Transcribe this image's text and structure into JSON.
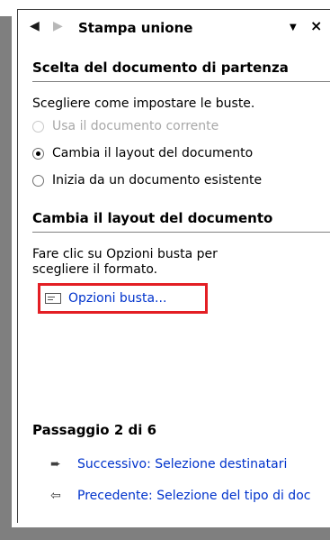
{
  "header": {
    "back_icon": "arrow-left-icon",
    "forward_icon": "arrow-right-icon",
    "title": "Stampa unione",
    "menu_icon": "chevron-down-icon",
    "close_icon": "close-icon"
  },
  "section1": {
    "title": "Scelta del documento di partenza",
    "instruction": "Scegliere come impostare le buste.",
    "options": [
      {
        "label": "Usa il documento corrente",
        "selected": false,
        "enabled": false
      },
      {
        "label": "Cambia il layout del documento",
        "selected": true,
        "enabled": true
      },
      {
        "label": "Inizia da un documento esistente",
        "selected": false,
        "enabled": true
      }
    ]
  },
  "section2": {
    "title": "Cambia il layout del documento",
    "text_line1": "Fare clic su Opzioni busta per",
    "text_line2": "scegliere il formato.",
    "link_label": "Opzioni busta...",
    "link_icon": "envelope-icon",
    "highlight_color": "#e31e24"
  },
  "footer": {
    "step": "Passaggio 2 di 6",
    "next_label": "Successivo: Selezione destinatari",
    "prev_label": "Precedente: Selezione del tipo di doc"
  }
}
